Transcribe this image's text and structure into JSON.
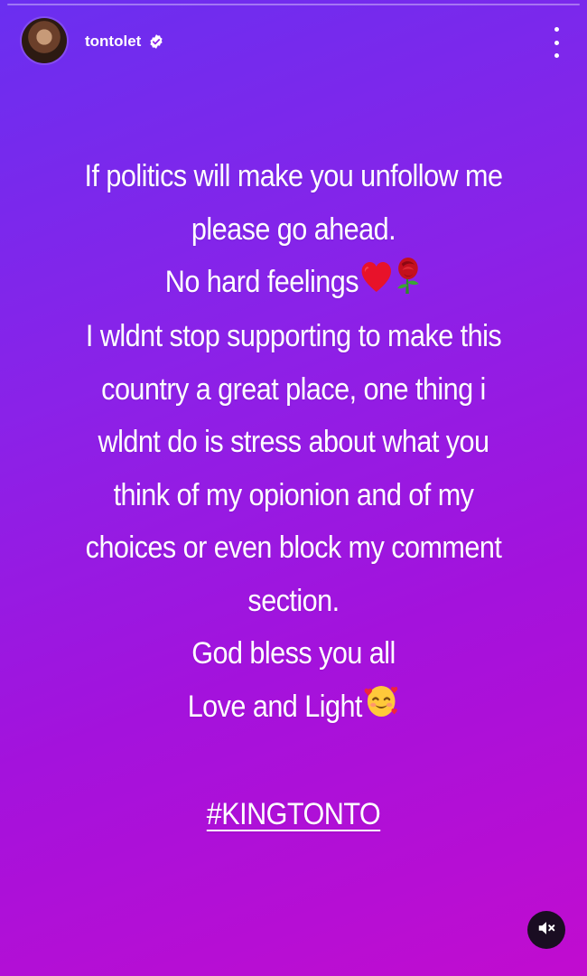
{
  "header": {
    "username": "tontolet",
    "verified": true,
    "avatar": "profile-avatar",
    "more_icon": "more-vertical-icon"
  },
  "story": {
    "lines": [
      "If politics will make you unfollow me",
      "please go ahead.",
      "No hard feelings",
      "I wldnt stop supporting to make this",
      "country a great place, one thing i",
      "wldnt do is stress about what you",
      "think of my opionion and of my",
      "choices or even block my comment",
      "section.",
      "God bless you all",
      "Love and Light"
    ],
    "emojis": {
      "line3": [
        "red-heart-emoji",
        "rose-emoji"
      ],
      "line11": [
        "smiling-face-with-hearts-emoji"
      ]
    },
    "hashtag": "#KINGTONTO"
  },
  "controls": {
    "mute_icon": "speaker-muted-icon"
  },
  "colors": {
    "gradient_start": "#6a2ff0",
    "gradient_mid": "#a412dc",
    "gradient_end": "#c10ccf",
    "text": "#ffffff",
    "verified_badge": "#ffffff"
  }
}
